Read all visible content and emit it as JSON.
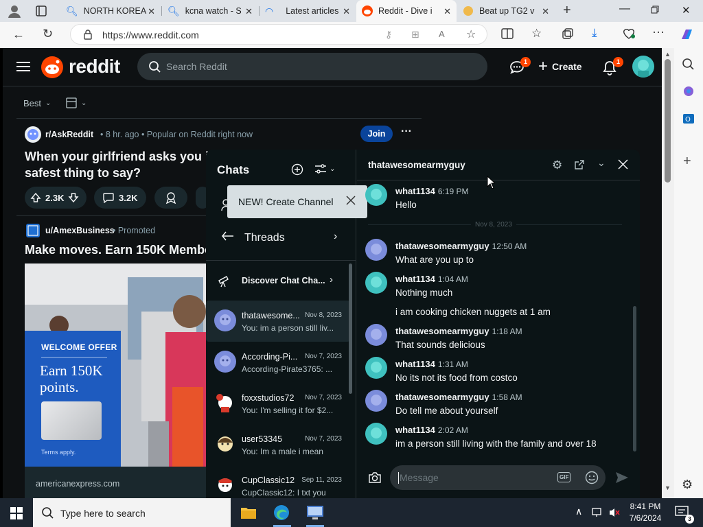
{
  "browser": {
    "tabs": [
      {
        "title": "NORTH KOREA",
        "icon": "search-icon"
      },
      {
        "title": "kcna watch - S",
        "icon": "search-icon"
      },
      {
        "title": "Latest articles",
        "icon": "edge-icon"
      },
      {
        "title": "Reddit - Dive i",
        "icon": "reddit-icon"
      },
      {
        "title": "Beat up TG2 v",
        "icon": "coin-icon"
      }
    ],
    "url": "https://www.reddit.com"
  },
  "reddit": {
    "logo_text": "reddit",
    "search_placeholder": "Search Reddit",
    "create_label": "Create",
    "chat_badge": "1",
    "notif_badge": "1",
    "sort_label": "Best",
    "post1": {
      "subreddit": "r/AskReddit",
      "meta": "• 8 hr. ago • Popular on Reddit right now",
      "join_label": "Join",
      "title_line1": "When your girlfriend asks you if I",
      "title_line2": "safest thing to say?",
      "upvotes": "2.3K",
      "comments": "3.2K"
    },
    "post2": {
      "author": "u/AmexBusiness",
      "meta": "• Promoted",
      "title": "Make moves. Earn 150K Member",
      "ad_offer": "WELCOME OFFER",
      "ad_headline1": "Earn 150K",
      "ad_headline2": "points.",
      "ad_terms": "Terms apply.",
      "ad_domain": "americanexpress.com"
    }
  },
  "chat": {
    "header_title": "Chats",
    "tooltip": "NEW! Create Channel",
    "threads_label": "Threads",
    "discover_label": "Discover Chat Cha...",
    "conversations": [
      {
        "name": "thatawesome...",
        "date": "Nov 8, 2023",
        "preview": "You: im a person still liv..."
      },
      {
        "name": "According-Pi...",
        "date": "Nov 7, 2023",
        "preview": "According-Pirate3765: ..."
      },
      {
        "name": "foxxstudios72",
        "date": "Nov 7, 2023",
        "preview": "You: I'm selling it for $2..."
      },
      {
        "name": "user53345",
        "date": "Nov 7, 2023",
        "preview": "You: Im a male i mean"
      },
      {
        "name": "CupClassic12",
        "date": "Sep 11, 2023",
        "preview": "CupClassic12: I txt you"
      }
    ],
    "active_user": "thatawesomearmyguy",
    "date_divider": "Nov 8, 2023",
    "messages": [
      {
        "user": "what1134",
        "time": "6:19 PM",
        "text": "Hello"
      },
      {
        "user": "thatawesomearmyguy",
        "time": "12:50 AM",
        "text": "What are you up to"
      },
      {
        "user": "what1134",
        "time": "1:04 AM",
        "text": "Nothing much"
      },
      {
        "user": "",
        "time": "",
        "text": "i am cooking chicken nuggets at 1 am"
      },
      {
        "user": "thatawesomearmyguy",
        "time": "1:18 AM",
        "text": "That sounds delicious"
      },
      {
        "user": "what1134",
        "time": "1:31 AM",
        "text": "No its not its food from costco"
      },
      {
        "user": "thatawesomearmyguy",
        "time": "1:58 AM",
        "text": "Do tell me about yourself"
      },
      {
        "user": "what1134",
        "time": "2:02 AM",
        "text": "im a person still living with the family and over 18"
      }
    ],
    "message_placeholder": "Message",
    "gif_label": "GIF"
  },
  "taskbar": {
    "search_placeholder": "Type here to search",
    "time": "8:41 PM",
    "date": "7/6/2024"
  },
  "colors": {
    "reddit_bg": "#0e1113",
    "reddit_orange": "#ff4500",
    "join_blue": "#0a449b",
    "avatar_teal": "#3fc1bf",
    "avatar_blue": "#7b8cdb"
  }
}
